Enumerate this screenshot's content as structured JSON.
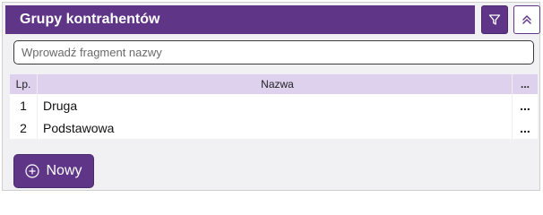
{
  "header": {
    "title": "Grupy kontrahentów",
    "filter_icon": "filter-icon",
    "collapse_icon": "chevrons-up-icon"
  },
  "search": {
    "placeholder": "Wprowadź fragment nazwy",
    "value": ""
  },
  "table": {
    "columns": [
      "Lp.",
      "Nazwa",
      "..."
    ],
    "rows": [
      {
        "lp": "1",
        "name": "Druga",
        "actions": "..."
      },
      {
        "lp": "2",
        "name": "Podstawowa",
        "actions": "..."
      }
    ]
  },
  "footer": {
    "new_label": "Nowy",
    "new_icon": "plus-circle-icon"
  },
  "colors": {
    "accent": "#5e3587",
    "header_row": "#ddd1ee",
    "panel_bg": "#f1f1f3"
  }
}
